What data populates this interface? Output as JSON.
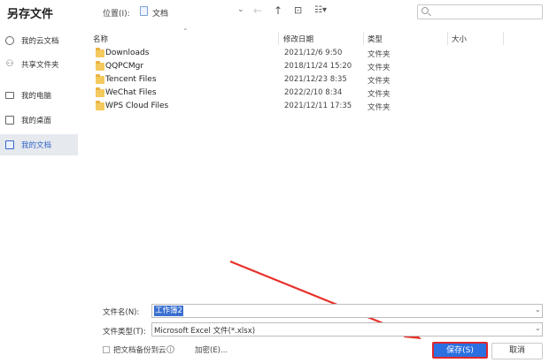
{
  "dialog": {
    "title": "另存文件"
  },
  "location": {
    "label": "位置(I):",
    "value": "文档"
  },
  "toolbar": {
    "back": "←",
    "up": "↑",
    "new_folder": "⊡",
    "view": "☷▾"
  },
  "search": {
    "placeholder": ""
  },
  "sidebar": {
    "items": [
      {
        "label": "我的云文档",
        "icon": "cloud-icon"
      },
      {
        "label": "共享文件夹",
        "icon": "share-icon"
      },
      {
        "label": "我的电脑",
        "icon": "computer-icon"
      },
      {
        "label": "我的桌面",
        "icon": "desktop-icon"
      },
      {
        "label": "我的文档",
        "icon": "documents-icon",
        "active": true
      }
    ]
  },
  "file_list": {
    "columns": [
      "名称",
      "修改日期",
      "类型",
      "大小"
    ],
    "rows": [
      {
        "name": "Downloads",
        "date": "2021/12/6 9:50",
        "type": "文件夹"
      },
      {
        "name": "QQPCMgr",
        "date": "2018/11/24 15:20",
        "type": "文件夹"
      },
      {
        "name": "Tencent Files",
        "date": "2021/12/23 8:35",
        "type": "文件夹"
      },
      {
        "name": "WeChat Files",
        "date": "2022/2/10 8:34",
        "type": "文件夹"
      },
      {
        "name": "WPS Cloud Files",
        "date": "2021/12/11 17:35",
        "type": "文件夹"
      }
    ]
  },
  "form": {
    "filename_label": "文件名(N):",
    "filename_value": "工作簿2",
    "filetype_label": "文件类型(T):",
    "filetype_value": "Microsoft Excel 文件(*.xlsx)",
    "backup_label": "把文档备份到云",
    "encrypt_label": "加密(E)..."
  },
  "buttons": {
    "save": "保存(S)",
    "cancel": "取消"
  },
  "colors": {
    "accent": "#2c6fe0",
    "highlight_border": "#e0272d",
    "arrow": "#e8302a"
  }
}
